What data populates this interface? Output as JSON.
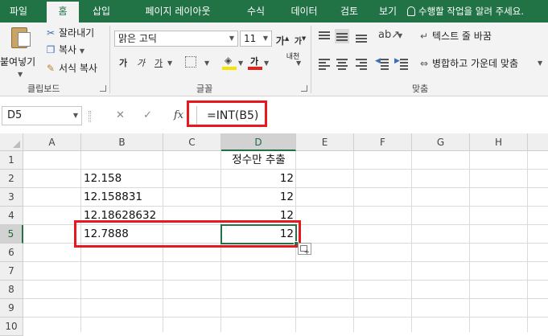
{
  "ribbon_tabs": [
    "파일",
    "홈",
    "삽입",
    "페이지 레이아웃",
    "수식",
    "데이터",
    "검토",
    "보기"
  ],
  "active_tab": "홈",
  "tell_me": "수행할 작업을 알려 주세요.",
  "clipboard": {
    "paste": "붙여넣기",
    "cut": "잘라내기",
    "copy": "복사",
    "format_painter": "서식 복사",
    "group_label": "클립보드"
  },
  "font": {
    "name": "맑은 고딕",
    "size": "11",
    "grow": "가",
    "shrink": "가",
    "bold": "가",
    "italic": "가",
    "underline": "가",
    "font_color": "가",
    "phonetic": "내천",
    "group_label": "글꼴",
    "fill_color": "#f5e400",
    "text_color": "#e2231a"
  },
  "alignment": {
    "wrap_text": "텍스트 줄 바꿈",
    "merge_center": "병합하고 가운데 맞춤",
    "group_label": "맞춤"
  },
  "formula_bar": {
    "name_box": "D5",
    "cancel": "✕",
    "enter": "✓",
    "fx": "fx",
    "formula": "=INT(B5)"
  },
  "sheet": {
    "columns": [
      "A",
      "B",
      "C",
      "D",
      "E",
      "F",
      "G",
      "H"
    ],
    "rows": [
      "1",
      "2",
      "3",
      "4",
      "5",
      "6",
      "7",
      "8",
      "9",
      "10"
    ],
    "header_d1": "정수만 추출",
    "b_values": [
      "12.158",
      "12.158831",
      "12.18628632",
      "12.7888"
    ],
    "d_values": [
      "12",
      "12",
      "12",
      "12"
    ],
    "selected_cell": "D5",
    "accent": "#217346",
    "highlight": "#e8191e"
  }
}
